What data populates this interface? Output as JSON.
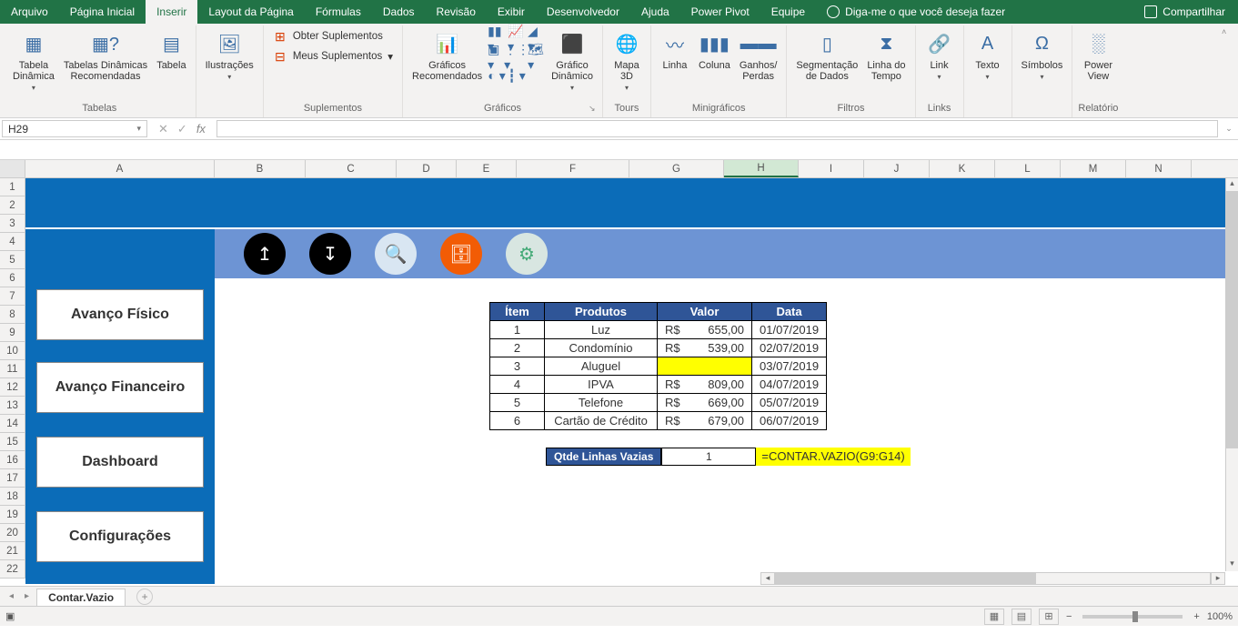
{
  "menubar": {
    "tabs": [
      "Arquivo",
      "Página Inicial",
      "Inserir",
      "Layout da Página",
      "Fórmulas",
      "Dados",
      "Revisão",
      "Exibir",
      "Desenvolvedor",
      "Ajuda",
      "Power Pivot",
      "Equipe"
    ],
    "active_index": 2,
    "tell_me": "Diga-me o que você deseja fazer",
    "share": "Compartilhar"
  },
  "ribbon": {
    "groups": {
      "tabelas": {
        "label": "Tabelas",
        "items": {
          "pivot": "Tabela\nDinâmica",
          "recommended_pivot": "Tabelas Dinâmicas\nRecomendadas",
          "table": "Tabela"
        }
      },
      "ilustracoes": {
        "label": "",
        "item": "Ilustrações"
      },
      "suplementos": {
        "label": "Suplementos",
        "get": "Obter Suplementos",
        "mine": "Meus Suplementos"
      },
      "graficos": {
        "label": "Gráficos",
        "recommended": "Gráficos\nRecomendados",
        "pivot_chart": "Gráfico\nDinâmico"
      },
      "tours": {
        "label": "Tours",
        "map3d": "Mapa\n3D"
      },
      "mini": {
        "label": "Minigráficos",
        "line": "Linha",
        "column": "Coluna",
        "winloss": "Ganhos/\nPerdas"
      },
      "filtros": {
        "label": "Filtros",
        "slicer": "Segmentação\nde Dados",
        "timeline": "Linha do\nTempo"
      },
      "links": {
        "label": "Links",
        "link": "Link"
      },
      "texto": {
        "label": "",
        "text": "Texto"
      },
      "simbolos": {
        "label": "",
        "symbol": "Símbolos"
      },
      "relatorio": {
        "label": "Relatório",
        "pv": "Power\nView"
      }
    }
  },
  "namebox": "H29",
  "formula": "",
  "columns": {
    "letters": [
      "A",
      "B",
      "C",
      "D",
      "E",
      "F",
      "G",
      "H",
      "I",
      "J",
      "K",
      "L",
      "M",
      "N"
    ],
    "widths": [
      208,
      100,
      100,
      66,
      66,
      124,
      104,
      82,
      72,
      72,
      72,
      72,
      72,
      72
    ],
    "selected_index": 7
  },
  "row_count": 22,
  "nav_buttons": [
    "Avanço Físico",
    "Avanço Financeiro",
    "Dashboard",
    "Configurações"
  ],
  "icon_circles": [
    "upload-icon",
    "download-icon",
    "search-doc-icon",
    "database-icon",
    "gears-icon"
  ],
  "circle_glyphs": [
    "↥",
    "↧",
    "🔍",
    "🗄",
    "⚙"
  ],
  "table": {
    "headers": [
      "Ítem",
      "Produtos",
      "Valor",
      "Data"
    ],
    "rows": [
      {
        "item": "1",
        "prod": "Luz",
        "cur": "R$",
        "val": "655,00",
        "date": "01/07/2019",
        "hl": false
      },
      {
        "item": "2",
        "prod": "Condomínio",
        "cur": "R$",
        "val": "539,00",
        "date": "02/07/2019",
        "hl": false
      },
      {
        "item": "3",
        "prod": "Aluguel",
        "cur": "",
        "val": "",
        "date": "03/07/2019",
        "hl": true
      },
      {
        "item": "4",
        "prod": "IPVA",
        "cur": "R$",
        "val": "809,00",
        "date": "04/07/2019",
        "hl": false
      },
      {
        "item": "5",
        "prod": "Telefone",
        "cur": "R$",
        "val": "669,00",
        "date": "05/07/2019",
        "hl": false
      },
      {
        "item": "6",
        "prod": "Cartão de Crédito",
        "cur": "R$",
        "val": "679,00",
        "date": "06/07/2019",
        "hl": false
      }
    ]
  },
  "blank_row": {
    "label": "Qtde Linhas Vazias",
    "value": "1",
    "formula": "=CONTAR.VAZIO(G9:G14)"
  },
  "sheet_tab": "Contar.Vazio",
  "zoom": "100%",
  "chart_data": {
    "type": "table",
    "title": "Qtde Linhas Vazias via CONTAR.VAZIO",
    "headers": [
      "Ítem",
      "Produtos",
      "Valor",
      "Data"
    ],
    "rows": [
      [
        1,
        "Luz",
        655.0,
        "01/07/2019"
      ],
      [
        2,
        "Condomínio",
        539.0,
        "02/07/2019"
      ],
      [
        3,
        "Aluguel",
        null,
        "03/07/2019"
      ],
      [
        4,
        "IPVA",
        809.0,
        "04/07/2019"
      ],
      [
        5,
        "Telefone",
        669.0,
        "05/07/2019"
      ],
      [
        6,
        "Cartão de Crédito",
        679.0,
        "06/07/2019"
      ]
    ],
    "derived": {
      "Qtde Linhas Vazias": 1,
      "formula": "=CONTAR.VAZIO(G9:G14)"
    }
  }
}
